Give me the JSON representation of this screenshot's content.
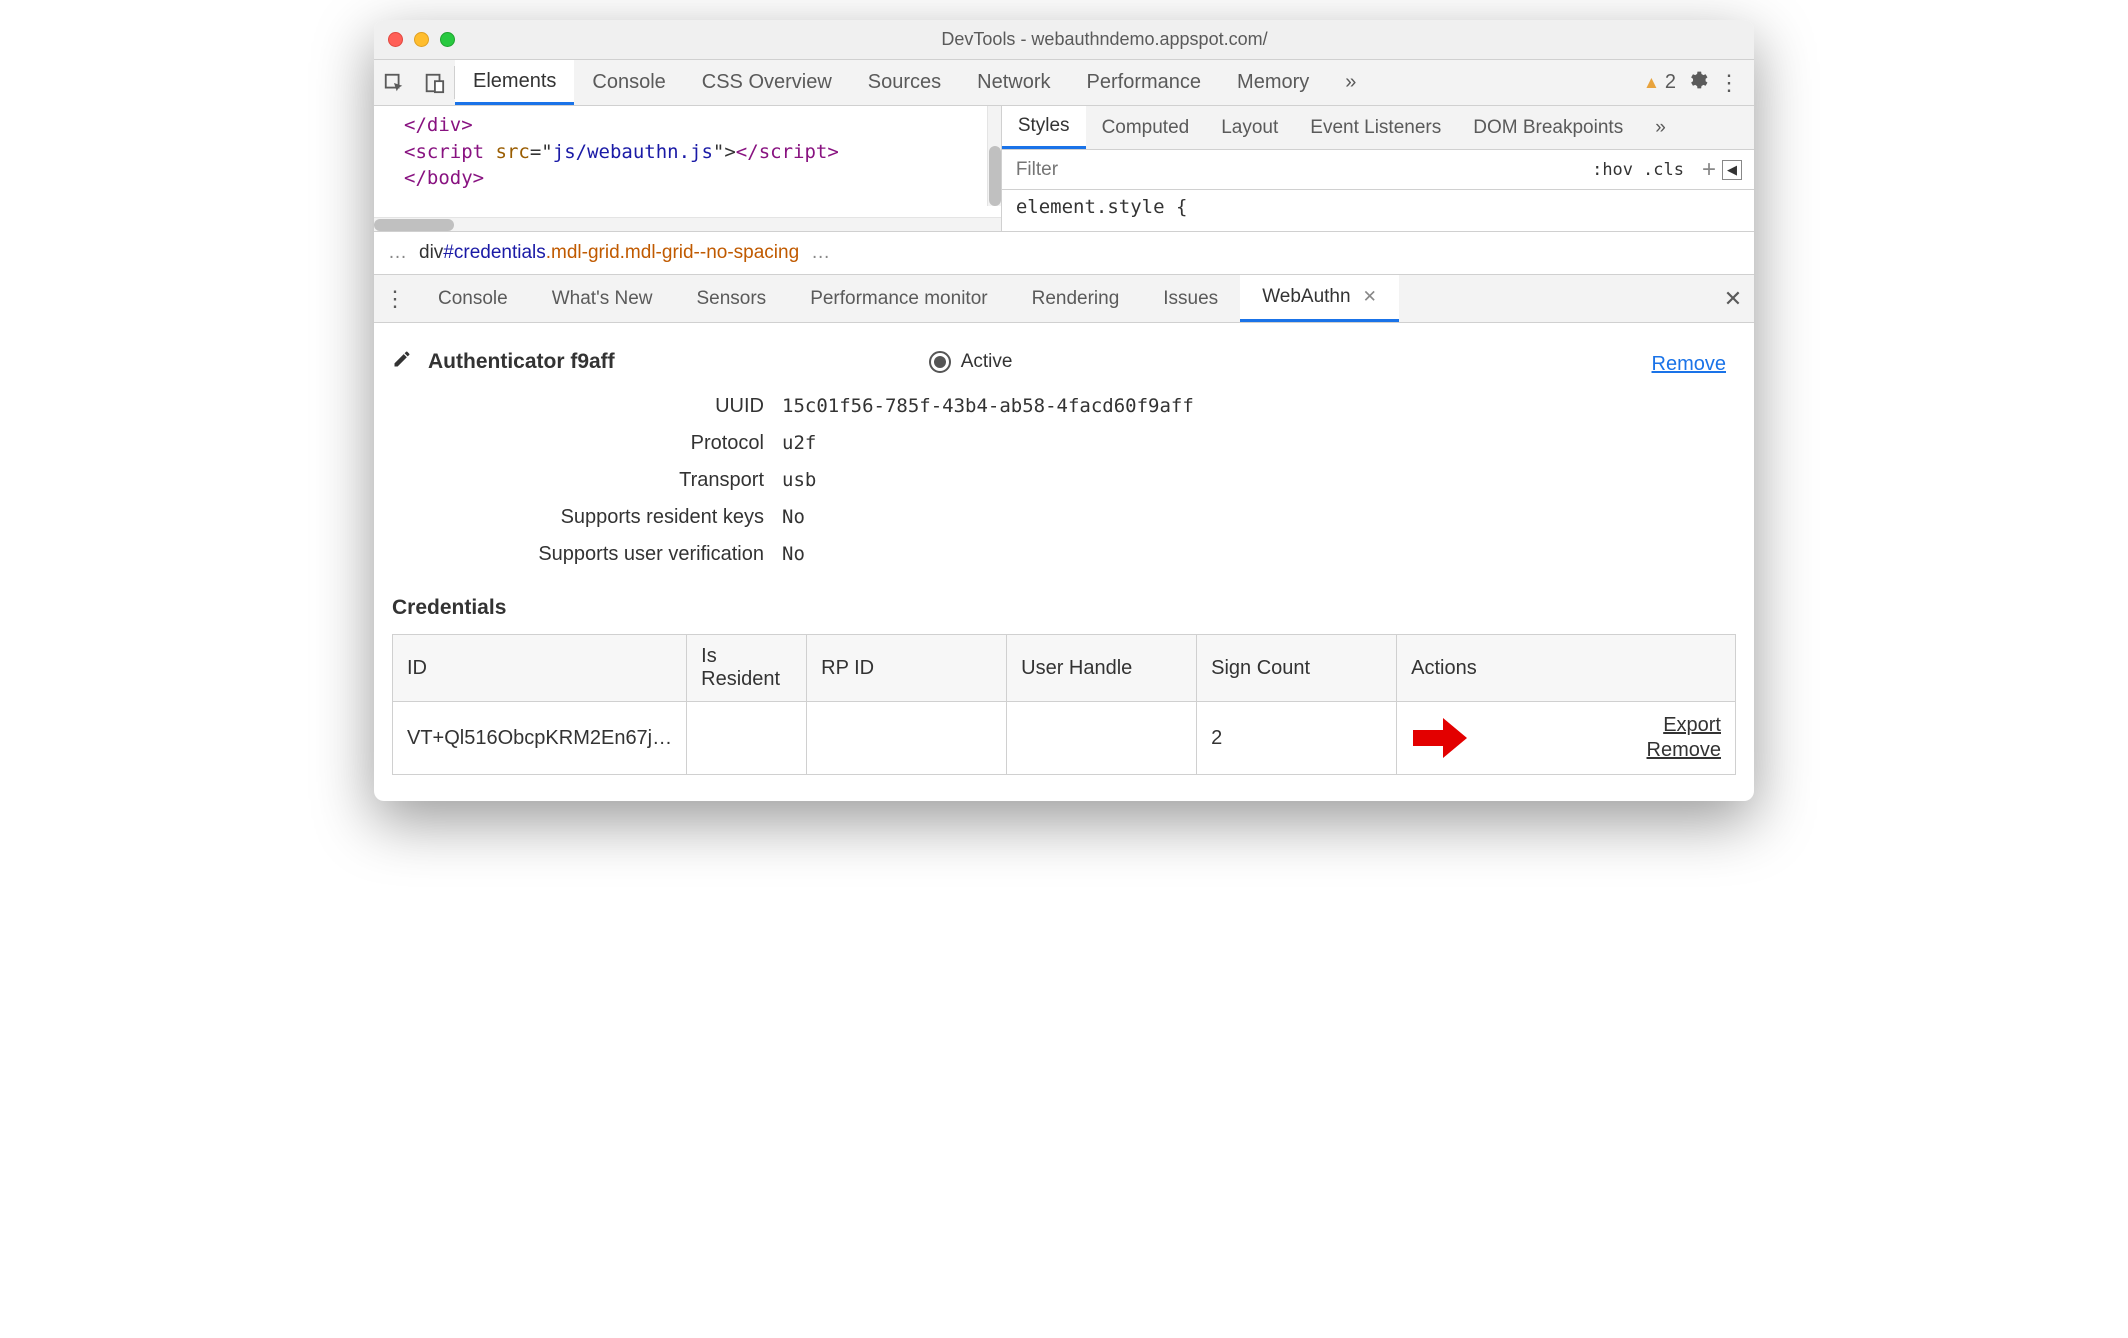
{
  "window_title": "DevTools - webauthndemo.appspot.com/",
  "main_tabs": {
    "elements": "Elements",
    "console": "Console",
    "css_overview": "CSS Overview",
    "sources": "Sources",
    "network": "Network",
    "performance": "Performance",
    "memory": "Memory",
    "overflow": "»"
  },
  "warning_count": "2",
  "code": {
    "line1_close_div": "</div>",
    "line2_open": "<script ",
    "line2_attr": "src",
    "line2_eq": "=\"",
    "line2_val": "js/webauthn.js",
    "line2_close": "\"></scr",
    "line2_close2": "ipt>",
    "line3_close_body": "</body>"
  },
  "styles_tabs": {
    "styles": "Styles",
    "computed": "Computed",
    "layout": "Layout",
    "event_listeners": "Event Listeners",
    "dom_breakpoints": "DOM Breakpoints",
    "overflow": "»"
  },
  "filter_placeholder": "Filter",
  "hov": ":hov",
  "cls": ".cls",
  "element_style": "element.style {",
  "breadcrumb": {
    "left_ell": "…",
    "tag": "div",
    "id": "#credentials",
    "cls1": ".mdl-grid",
    "cls2": ".mdl-grid--no-spacing",
    "right_ell": "…"
  },
  "drawer": {
    "console": "Console",
    "whats_new": "What's New",
    "sensors": "Sensors",
    "perf_monitor": "Performance monitor",
    "rendering": "Rendering",
    "issues": "Issues",
    "webauthn": "WebAuthn"
  },
  "auth": {
    "name": "Authenticator f9aff",
    "active": "Active",
    "remove": "Remove"
  },
  "props": {
    "uuid_label": "UUID",
    "uuid_value": "15c01f56-785f-43b4-ab58-4facd60f9aff",
    "protocol_label": "Protocol",
    "protocol_value": "u2f",
    "transport_label": "Transport",
    "transport_value": "usb",
    "resident_label": "Supports resident keys",
    "resident_value": "No",
    "userverif_label": "Supports user verification",
    "userverif_value": "No"
  },
  "credentials_title": "Credentials",
  "cred_headers": {
    "id": "ID",
    "is_resident": "Is Resident",
    "rp_id": "RP ID",
    "user_handle": "User Handle",
    "sign_count": "Sign Count",
    "actions": "Actions"
  },
  "cred_row": {
    "id": "VT+Ql516ObcpKRM2En67j…",
    "is_resident": "",
    "rp_id": "",
    "user_handle": "",
    "sign_count": "2",
    "export": "Export",
    "remove": "Remove"
  }
}
